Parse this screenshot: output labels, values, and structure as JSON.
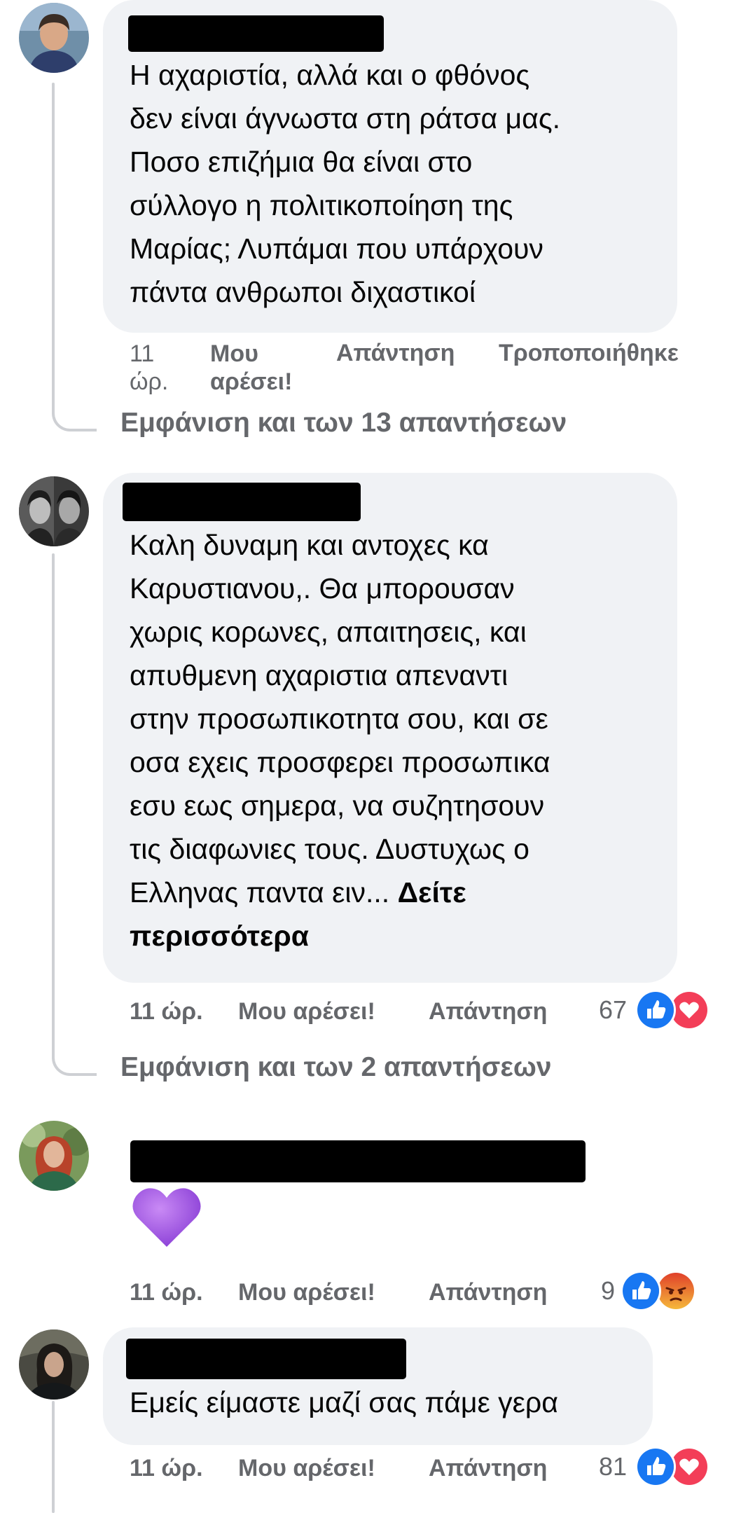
{
  "comments": [
    {
      "text": "Η αχαριστία, αλλά και ο φθόνος\nδεν είναι άγνωστα στη ράτσα μας.\nΠοσο επιζήμια θα είναι στο\nσύλλογο η πολιτικοποίηση της\nΜαρίας; Λυπάμαι που υπάρχουν\nπάντα ανθρωποι διχαστικοί",
      "time_a": "11",
      "time_b": "ώρ.",
      "like_a": "Μου",
      "like_b": "αρέσει!",
      "reply": "Απάντηση",
      "edited": "Τροποποιήθηκε",
      "view_replies": "Εμφάνιση και των 13 απαντήσεων"
    },
    {
      "text": "Καλη δυναμη και αντοχες κα\nΚαρυστιανου,. Θα μπορουσαν\nχωρις κορωνες, απαιτησεις, και\nαπυθμενη αχαριστια απεναντι\nστην προσωπικοτητα σου, και σε\nοσα εχεις προσφερει προσωπικα\nεσυ εως σημερα, να συζητησουν\nτις διαφωνιες τους. Δυστυχως ο\nΕλληνας παντα ειν... ",
      "see_more_a": "Δείτε",
      "see_more_b": "περισσότερα",
      "time": "11 ώρ.",
      "like": "Μου αρέσει!",
      "reply": "Απάντηση",
      "reaction_count": "67",
      "reactions": [
        "like-icon",
        "love-icon"
      ],
      "view_replies": "Εμφάνιση και των 2 απαντήσεων"
    },
    {
      "emoji": "purple-heart-emoji",
      "time": "11 ώρ.",
      "like": "Μου αρέσει!",
      "reply": "Απάντηση",
      "reaction_count": "9",
      "reactions": [
        "like-icon",
        "angry-icon"
      ]
    },
    {
      "text": "Εμείς είμαστε μαζί σας πάμε γερα",
      "time": "11 ώρ.",
      "like": "Μου αρέσει!",
      "reply": "Απάντηση",
      "reaction_count": "81",
      "reactions": [
        "like-icon",
        "love-icon"
      ]
    }
  ],
  "colors": {
    "bubble": "#f0f2f5",
    "meta_text": "#65676b",
    "like_blue": "#1877f2",
    "love_red": "#f33e58",
    "angry_orange": "#e9710f",
    "heart_purple": "#9b59e6",
    "thread_line": "#ced0d4"
  }
}
